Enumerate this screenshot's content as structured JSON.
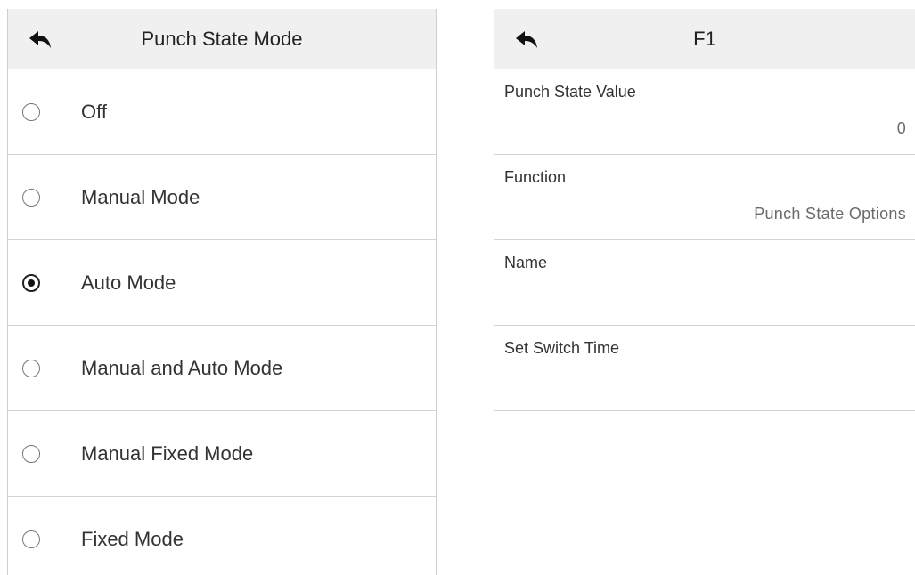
{
  "left": {
    "title": "Punch State Mode",
    "options": [
      {
        "label": "Off",
        "checked": false
      },
      {
        "label": "Manual Mode",
        "checked": false
      },
      {
        "label": "Auto Mode",
        "checked": true
      },
      {
        "label": "Manual and Auto Mode",
        "checked": false
      },
      {
        "label": "Manual Fixed Mode",
        "checked": false
      },
      {
        "label": "Fixed Mode",
        "checked": false
      }
    ]
  },
  "right": {
    "title": "F1",
    "fields": [
      {
        "label": "Punch State Value",
        "value": "0"
      },
      {
        "label": "Function",
        "value": "Punch State Options"
      },
      {
        "label": "Name",
        "value": ""
      },
      {
        "label": "Set Switch Time",
        "value": ""
      }
    ]
  },
  "icons": {
    "back": "back-arrow-icon"
  },
  "colors": {
    "header_bg": "#f0f0f0",
    "divider": "#d4d4d4",
    "text": "#333333"
  }
}
